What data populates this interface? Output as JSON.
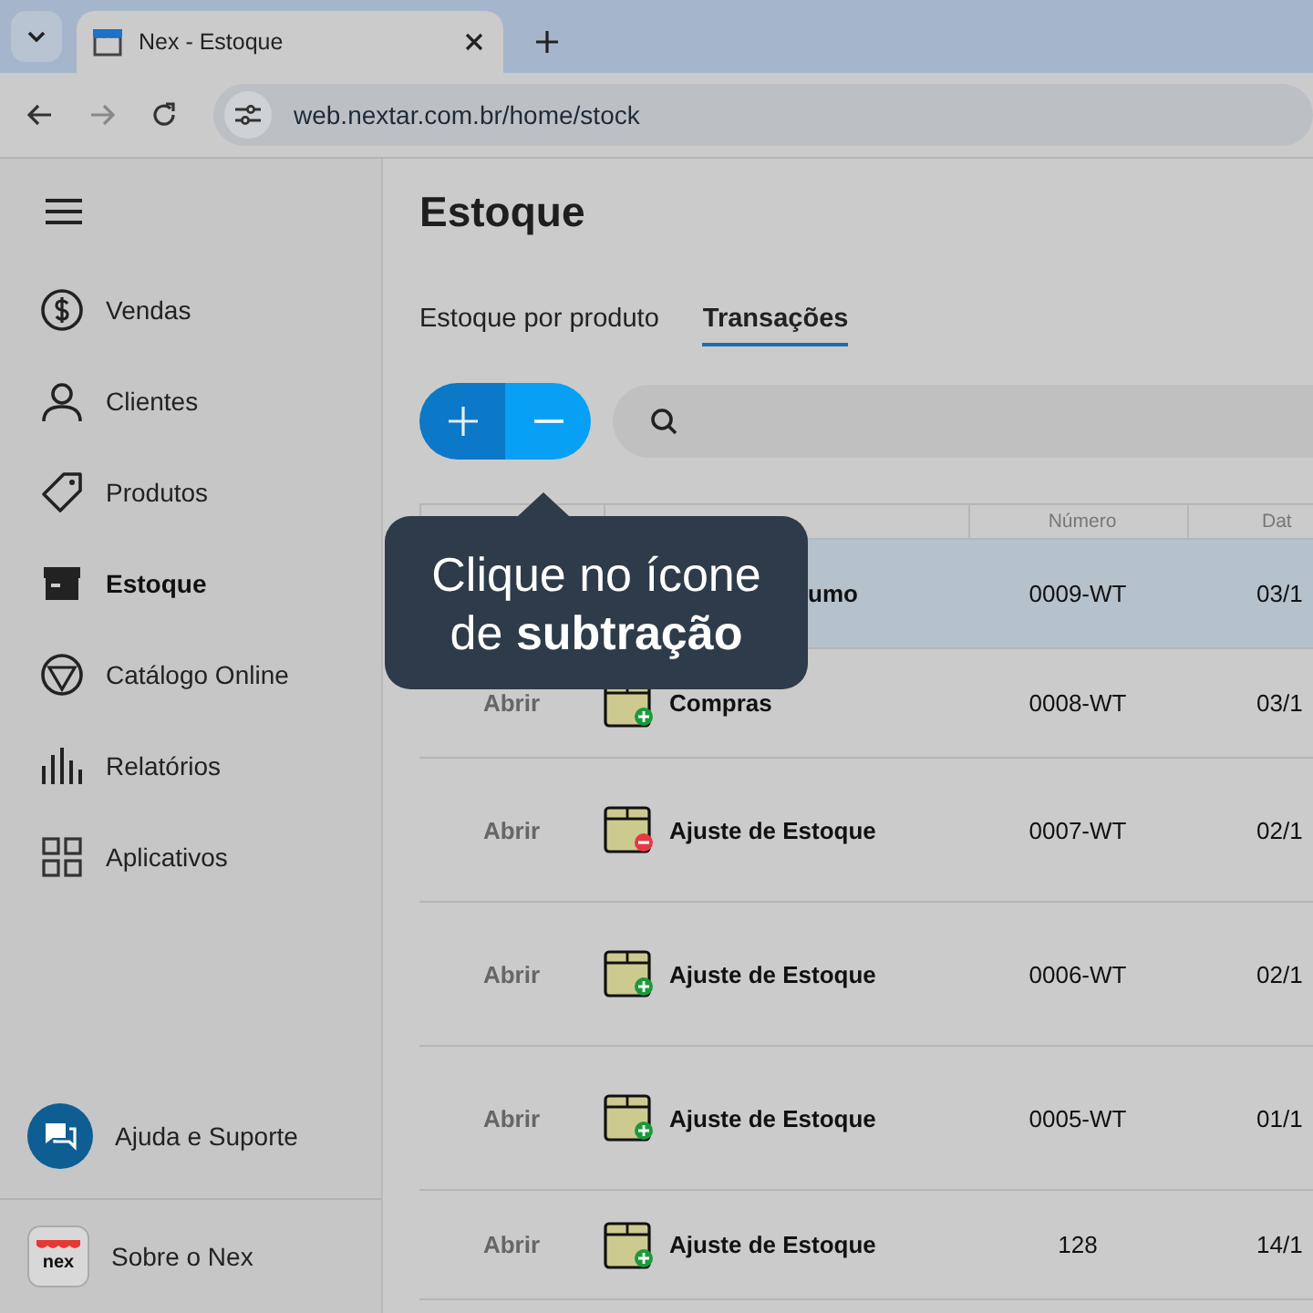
{
  "browser": {
    "tab_title": "Nex - Estoque",
    "url": "web.nextar.com.br/home/stock"
  },
  "sidebar": {
    "items": [
      {
        "label": "Vendas",
        "selected": false
      },
      {
        "label": "Clientes",
        "selected": false
      },
      {
        "label": "Produtos",
        "selected": false
      },
      {
        "label": "Estoque",
        "selected": true
      },
      {
        "label": "Catálogo Online",
        "selected": false
      },
      {
        "label": "Relatórios",
        "selected": false
      },
      {
        "label": "Aplicativos",
        "selected": false
      }
    ],
    "help": "Ajuda e Suporte",
    "about": "Sobre o Nex",
    "logo_text": "nex"
  },
  "page": {
    "title": "Estoque",
    "tabs": [
      {
        "label": "Estoque por produto",
        "selected": false
      },
      {
        "label": "Transações",
        "selected": true
      }
    ]
  },
  "tooltip": "Clique no ícone\nde **subtração**",
  "table": {
    "columns": [
      "Número",
      "Dat"
    ],
    "rows": [
      {
        "kind": "covered",
        "type": "umo",
        "number": "0009-WT",
        "date": "03/1",
        "selected": true
      },
      {
        "kind": "in",
        "open": "Abrir",
        "type": "Compras",
        "number": "0008-WT",
        "date": "03/1",
        "selected": false
      },
      {
        "kind": "out",
        "open": "Abrir",
        "type": "Ajuste de Estoque",
        "number": "0007-WT",
        "date": "02/1",
        "selected": false
      },
      {
        "kind": "in",
        "open": "Abrir",
        "type": "Ajuste de Estoque",
        "number": "0006-WT",
        "date": "02/1",
        "selected": false
      },
      {
        "kind": "in",
        "open": "Abrir",
        "type": "Ajuste de Estoque",
        "number": "0005-WT",
        "date": "01/1",
        "selected": false
      },
      {
        "kind": "in",
        "open": "Abrir",
        "type": "Ajuste de Estoque",
        "number": "128",
        "date": "14/1",
        "selected": false
      }
    ]
  }
}
